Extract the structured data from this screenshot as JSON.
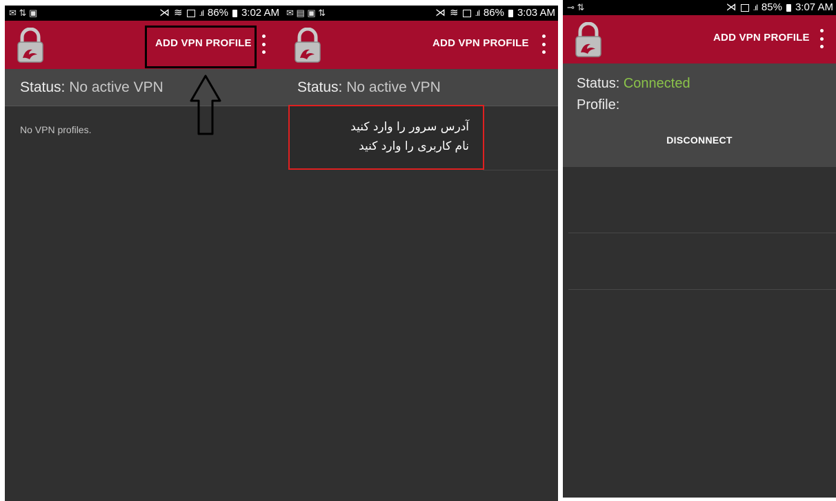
{
  "colors": {
    "app_bar": "#a50d2d",
    "background": "#303030",
    "status_panel": "#464646",
    "connected": "#8bc34a",
    "annotation_red": "#e02020"
  },
  "screens": [
    {
      "status_bar": {
        "left_icons": "✉ ⇅ ▣",
        "battery": "86%",
        "time": "3:02 AM"
      },
      "app_bar": {
        "action_label": "ADD VPN PROFILE",
        "menu_icon": "overflow-menu-icon",
        "logo_icon": "padlock-logo-icon"
      },
      "status": {
        "label": "Status:",
        "value": "No active VPN"
      },
      "empty_message": "No VPN profiles."
    },
    {
      "status_bar": {
        "left_icons": "✉ ▤ ▣ ⇅",
        "battery": "86%",
        "time": "3:03 AM"
      },
      "app_bar": {
        "action_label": "ADD VPN PROFILE",
        "menu_icon": "overflow-menu-icon",
        "logo_icon": "padlock-logo-icon"
      },
      "status": {
        "label": "Status:",
        "value": "No active VPN"
      },
      "note": {
        "line1": "آدرس سرور را وارد کنید",
        "line2": "نام کاربری را وارد کنید"
      }
    },
    {
      "status_bar": {
        "left_icons": "⊸ ⇅",
        "battery": "85%",
        "time": "3:07 AM"
      },
      "app_bar": {
        "action_label": "ADD VPN PROFILE",
        "menu_icon": "overflow-menu-icon",
        "logo_icon": "padlock-logo-icon"
      },
      "status": {
        "label": "Status:",
        "value": "Connected"
      },
      "profile": {
        "label": "Profile:",
        "value": ""
      },
      "disconnect_label": "DISCONNECT"
    }
  ]
}
